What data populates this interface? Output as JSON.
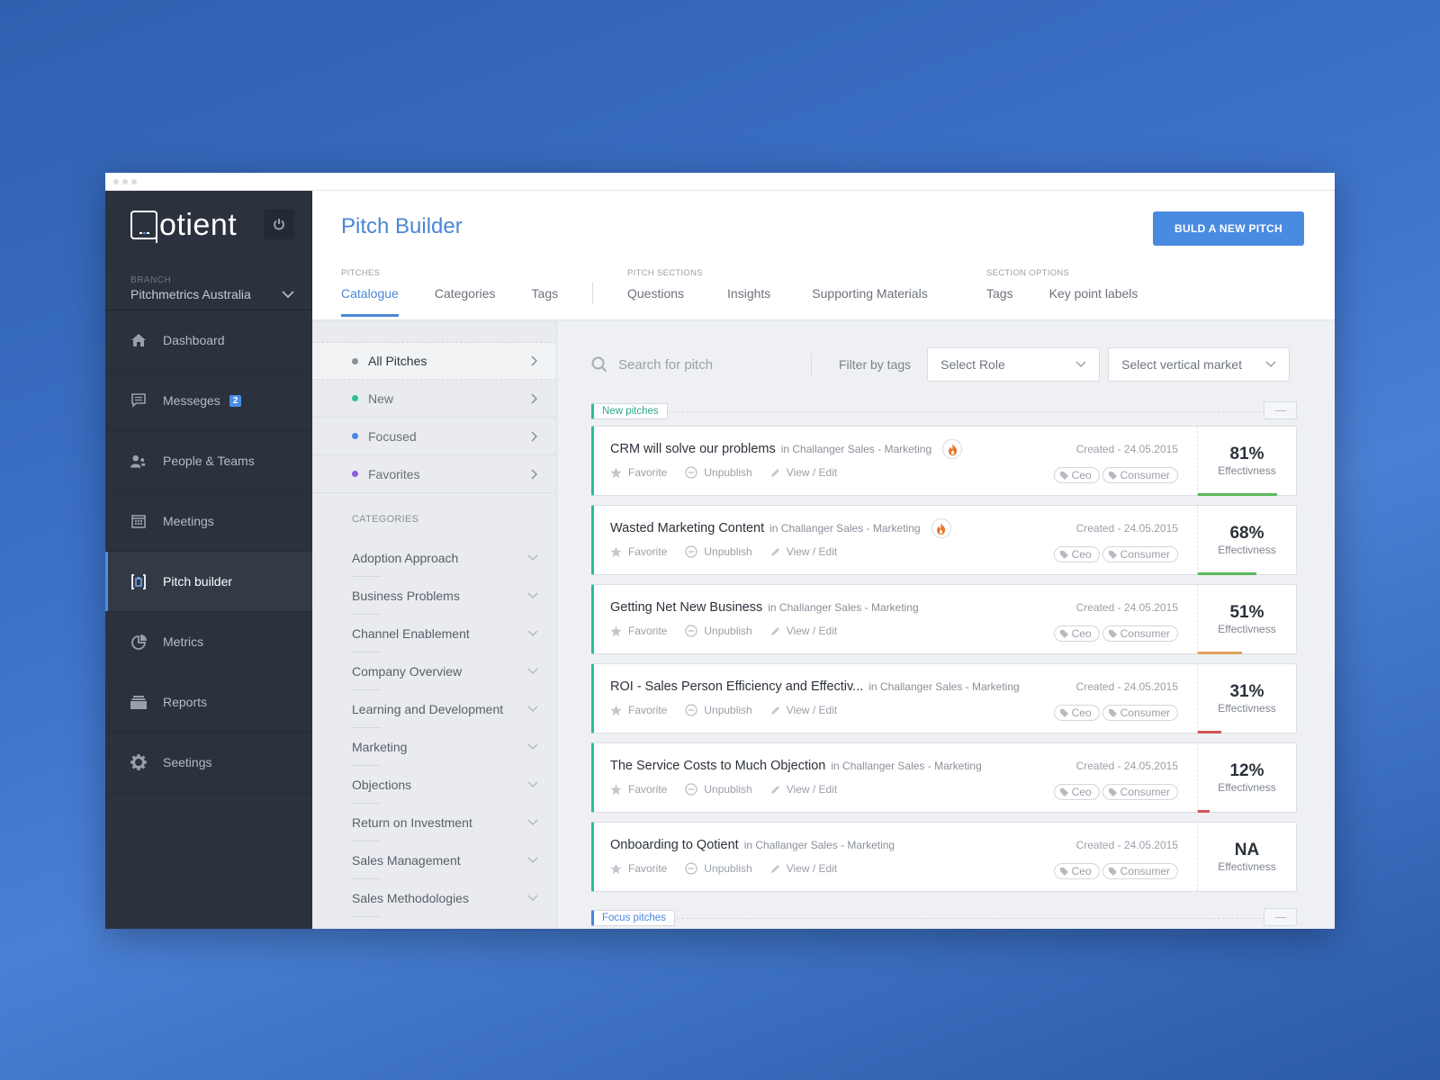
{
  "app": {
    "logo_text": "otient",
    "branch_label": "BRANCH",
    "branch_name": "Pitchmetrics Australia"
  },
  "sidebar": {
    "items": [
      {
        "label": "Dashboard",
        "icon": "home-icon"
      },
      {
        "label": "Messeges",
        "icon": "message-icon",
        "badge": "2"
      },
      {
        "label": "People & Teams",
        "icon": "people-icon"
      },
      {
        "label": "Meetings",
        "icon": "calendar-icon"
      },
      {
        "label": "Pitch builder",
        "icon": "pitch-icon",
        "active": true
      },
      {
        "label": "Metrics",
        "icon": "pie-chart-icon"
      },
      {
        "label": "Reports",
        "icon": "reports-icon"
      },
      {
        "label": "Seetings",
        "icon": "gear-icon"
      }
    ]
  },
  "header": {
    "title": "Pitch Builder",
    "build_button": "BULD A NEW PITCH",
    "groups": [
      {
        "label": "PITCHES",
        "tabs": [
          "Catalogue",
          "Categories",
          "Tags"
        ],
        "active": "Catalogue"
      },
      {
        "label": "PITCH SECTIONS",
        "tabs": [
          "Questions",
          "Insights",
          "Supporting Materials"
        ]
      },
      {
        "label": "SECTION OPTIONS",
        "tabs": [
          "Tags",
          "Key point labels"
        ]
      }
    ]
  },
  "filters": {
    "items": [
      {
        "label": "All Pitches",
        "color": "#8a9099",
        "active": true
      },
      {
        "label": "New",
        "color": "#2cbc9a"
      },
      {
        "label": "Focused",
        "color": "#4a86e0"
      },
      {
        "label": "Favorites",
        "color": "#8a5ee0"
      }
    ],
    "categories_heading": "CATEGORIES",
    "categories": [
      "Adoption Approach",
      "Business Problems",
      "Channel Enablement",
      "Company Overview",
      "Learning and Development",
      "Marketing",
      "Objections",
      "Return on Investment",
      "Sales Management",
      "Sales Methodologies"
    ]
  },
  "toolbar": {
    "search_placeholder": "Search for pitch",
    "filter_label": "Filter by tags",
    "role_select": "Select Role",
    "market_select": "Select vertical market"
  },
  "sections": {
    "new_label": "New pitches",
    "focus_label": "Focus pitches"
  },
  "actions": {
    "favorite": "Favorite",
    "unpublish": "Unpublish",
    "view_edit": "View / Edit",
    "eff_label": "Effectivness"
  },
  "pitches": [
    {
      "title": "CRM will solve our problems",
      "in": "in Challanger Sales - Marketing",
      "hot": true,
      "created": "Created - 24.05.2015",
      "tags": [
        "Ceo",
        "Consumer"
      ],
      "effectiveness": "81%",
      "eff_fraction": 0.81,
      "bar_color": "#5cb85c"
    },
    {
      "title": "Wasted Marketing Content",
      "in": "in Challanger Sales - Marketing",
      "hot": true,
      "created": "Created - 24.05.2015",
      "tags": [
        "Ceo",
        "Consumer"
      ],
      "effectiveness": "68%",
      "eff_fraction": 0.6,
      "bar_color": "#5cb85c"
    },
    {
      "title": "Getting Net New Business",
      "in": "in Challanger Sales - Marketing",
      "hot": false,
      "created": "Created - 24.05.2015",
      "tags": [
        "Ceo",
        "Consumer"
      ],
      "effectiveness": "51%",
      "eff_fraction": 0.45,
      "bar_color": "#e0a05a"
    },
    {
      "title": "ROI - Sales Person Efficiency and Effectiv...",
      "in": "in Challanger Sales - Marketing",
      "hot": false,
      "created": "Created - 24.05.2015",
      "tags": [
        "Ceo",
        "Consumer"
      ],
      "effectiveness": "31%",
      "eff_fraction": 0.24,
      "bar_color": "#d05555"
    },
    {
      "title": "The Service Costs to Much Objection",
      "in": "in Challanger Sales - Marketing",
      "hot": false,
      "created": "Created - 24.05.2015",
      "tags": [
        "Ceo",
        "Consumer"
      ],
      "effectiveness": "12%",
      "eff_fraction": 0.12,
      "bar_color": "#d05555"
    },
    {
      "title": "Onboarding to Qotient",
      "in": "in Challanger Sales - Marketing",
      "hot": false,
      "created": "Created - 24.05.2015",
      "tags": [
        "Ceo",
        "Consumer"
      ],
      "effectiveness": "NA",
      "eff_fraction": 0,
      "bar_color": "#d05555"
    }
  ]
}
